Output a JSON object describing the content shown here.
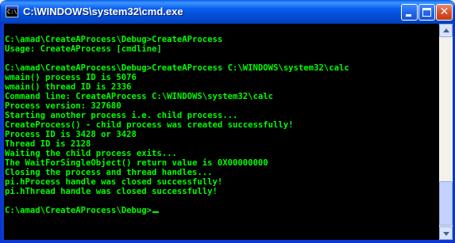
{
  "window": {
    "title": "C:\\WINDOWS\\system32\\cmd.exe",
    "icon": "cmd-icon",
    "icon_glyph": "C:\\"
  },
  "colors": {
    "console_text": "#00FF00",
    "console_background": "#000000",
    "titlebar": "#0450D8"
  },
  "console": {
    "lines": [
      "",
      "C:\\amad\\CreateAProcess\\Debug>CreateAProcess",
      "Usage: CreateAProcess [cmdline]",
      "",
      "C:\\amad\\CreateAProcess\\Debug>CreateAProcess C:\\WINDOWS\\system32\\calc",
      "wmain() process ID is 5076",
      "wmain() thread ID is 2336",
      "Command line: CreateAProcess C:\\WINDOWS\\system32\\calc",
      "Process version: 327680",
      "Starting another process i.e. child process...",
      "CreateProcess() - child process was created successfully!",
      "Process ID is 3428 or 3428",
      "Thread ID is 2128",
      "Waiting the child process exits...",
      "The WaitForSingleObject() return value is 0X00000000",
      "Closing the process and thread handles...",
      "pi.hProcess handle was closed successfully!",
      "pi.hThread handle was closed successfully!",
      "",
      "C:\\amad\\CreateAProcess\\Debug>"
    ]
  },
  "scrollbar": {
    "position": 0.95
  }
}
